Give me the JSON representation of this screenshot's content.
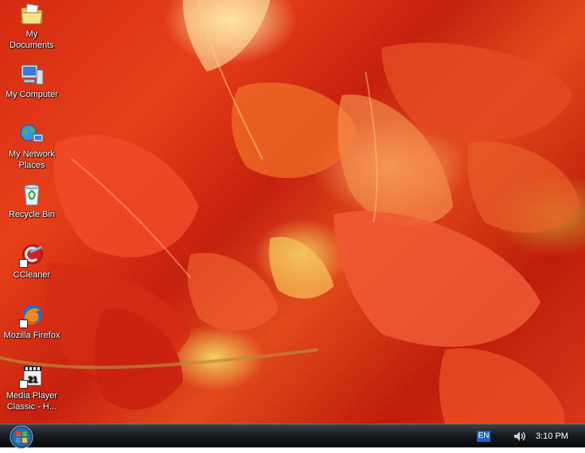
{
  "desktop_icons": [
    {
      "label": "My\nDocuments",
      "icon": "folder-documents-icon"
    },
    {
      "label": "My Computer",
      "icon": "computer-icon"
    },
    {
      "label": "My Network\nPlaces",
      "icon": "network-globe-icon"
    },
    {
      "label": "Recycle Bin",
      "icon": "recycle-bin-icon"
    },
    {
      "label": "CCleaner",
      "icon": "ccleaner-icon"
    },
    {
      "label": "Mozilla Firefox",
      "icon": "firefox-icon"
    },
    {
      "label": "Media Player\nClassic - H...",
      "icon": "media-player-icon"
    }
  ],
  "taskbar": {
    "language": "EN",
    "clock": "3:10 PM",
    "accent": "#1f63c9"
  }
}
